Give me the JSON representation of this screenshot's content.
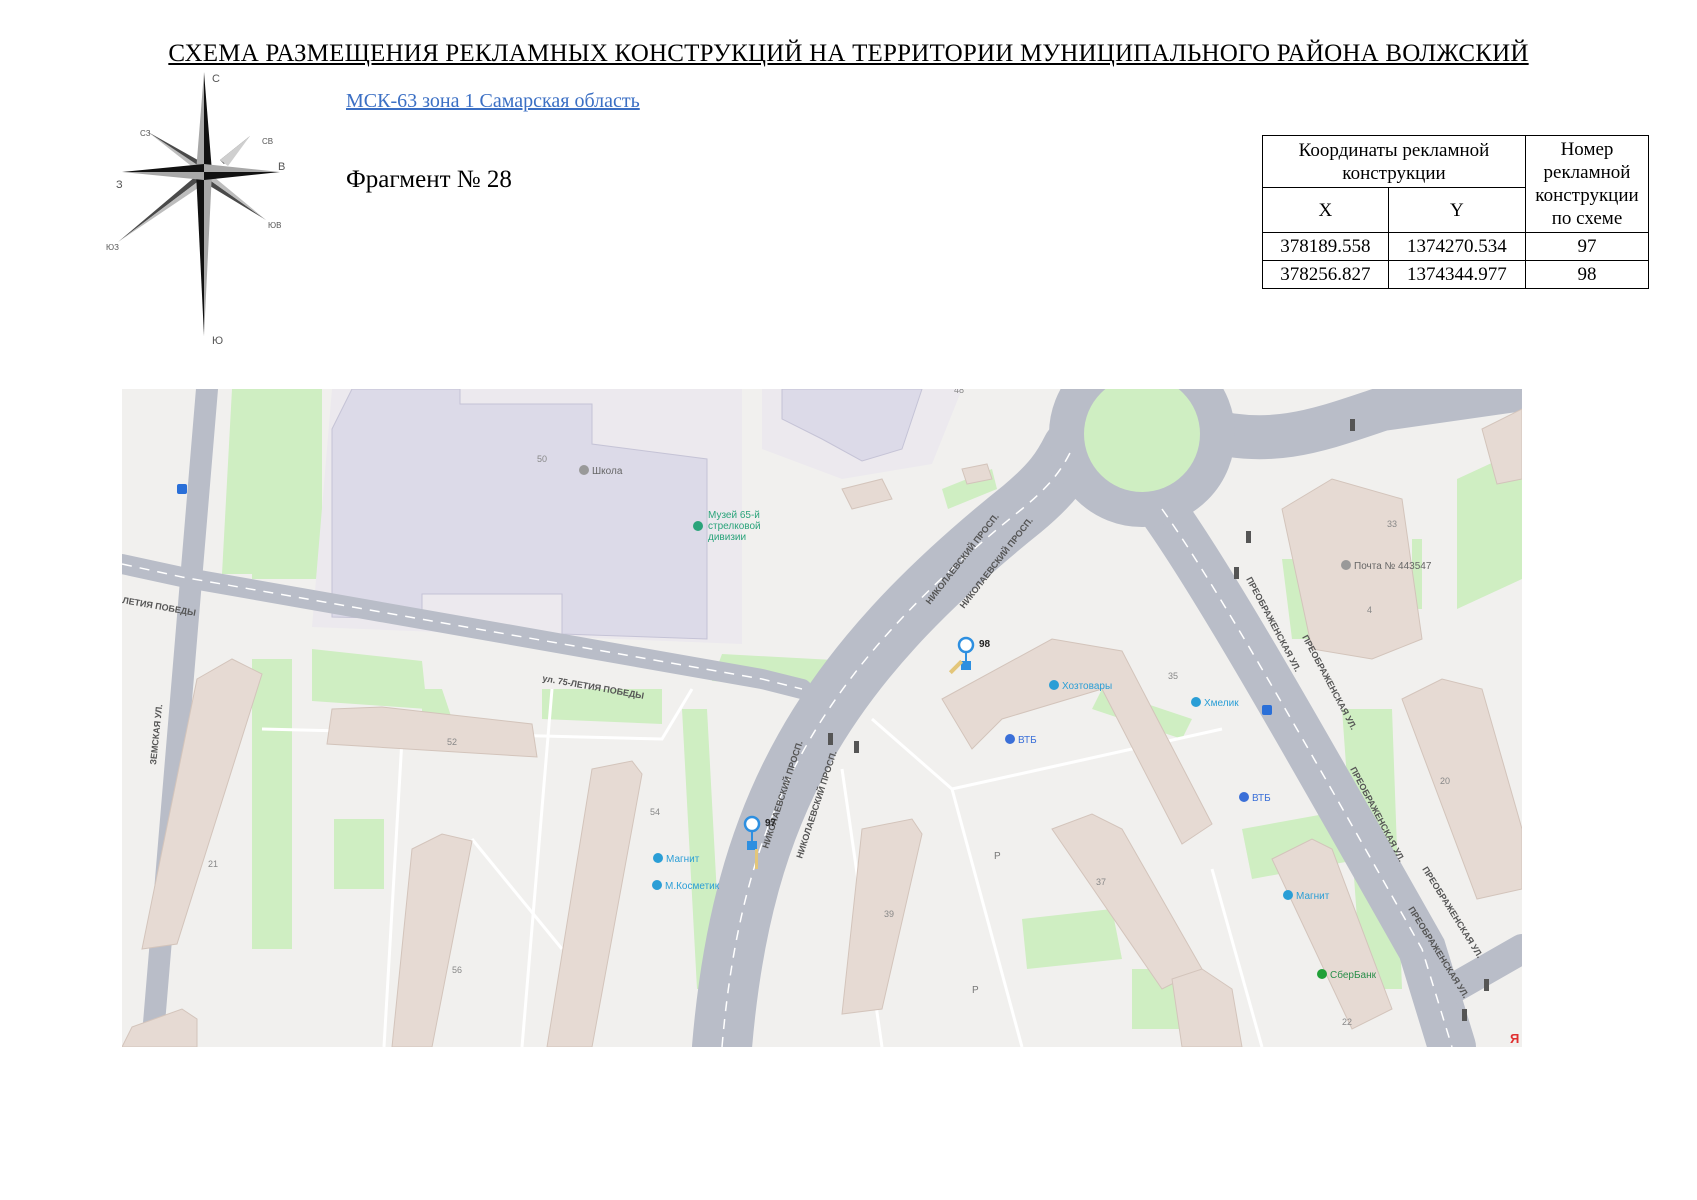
{
  "header": {
    "title": "СХЕМА РАЗМЕЩЕНИЯ РЕКЛАМНЫХ КОНСТРУКЦИЙ НА ТЕРРИТОРИИ МУНИЦИПАЛЬНОГО РАЙОНА ВОЛЖСКИЙ",
    "crs_link": "МСК-63 зона 1 Самарская область",
    "fragment": "Фрагмент № 28"
  },
  "compass": {
    "n": "С",
    "s": "Ю",
    "e": "В",
    "w": "З",
    "nw": "СЗ",
    "ne": "СВ",
    "se": "ЮВ",
    "sw": "ЮЗ"
  },
  "coords_table": {
    "header_coords": "Координаты рекламной конструкции",
    "header_x": "X",
    "header_y": "Y",
    "header_num": "Номер рекламной конструкции по схеме",
    "rows": [
      {
        "x": "378189.558",
        "y": "1374270.534",
        "num": "97"
      },
      {
        "x": "378256.827",
        "y": "1374344.977",
        "num": "98"
      }
    ]
  },
  "map": {
    "colors": {
      "road": "#b9bdc8",
      "green": "#cfeec2",
      "building": "#e6dad3",
      "school": "#dcdae8",
      "marker": "#2d8fe0"
    },
    "streets": {
      "pobedy_main": "ул. 75-ЛЕТИЯ ПОБЕДЫ",
      "pobedy_left": "ЛЕТИЯ ПОБЕДЫ",
      "zemskaya": "ЗЕМСКАЯ УЛ.",
      "nikolaevsky_1": "НИКОЛАЕВСКИЙ ПРОСП.",
      "nikolaevsky_2": "НИКОЛАЕВСКИЙ ПРОСП.",
      "nikolaevsky_3": "НИКОЛАЕВСКИЙ ПРОСП.",
      "nikolaevsky_4": "НИКОЛАЕВСКИЙ ПРОСП.",
      "preobr_1": "ПРЕОБРАЖЕНСКАЯ УЛ.",
      "preobr_2": "ПРЕОБРАЖЕНСКАЯ УЛ.",
      "preobr_3": "ПРЕОБРАЖЕНСКАЯ УЛ.",
      "preobr_4": "ПРЕОБРАЖЕНСКАЯ УЛ.",
      "preobr_5": "ПРЕОБРАЖЕНСКАЯ УЛ."
    },
    "pois": {
      "school": "Школа",
      "museum_1": "Музей 65-й",
      "museum_2": "стрелковой",
      "museum_3": "дивизии",
      "post": "Почта № 443547",
      "hoztovary": "Хозтовары",
      "hmelik": "Хмелик",
      "vtb_1": "ВТБ",
      "vtb_2": "ВТБ",
      "magnit_1": "Магнит",
      "kosmetik": "М.Косметик",
      "magnit_2": "Магнит",
      "sber": "СберБанк"
    },
    "houses": {
      "h50": "50",
      "h48": "48",
      "h33": "33",
      "h4": "4",
      "h35": "35",
      "h52": "52",
      "h54": "54",
      "h20": "20",
      "h21": "21",
      "h56": "56",
      "h39": "39",
      "h37": "37",
      "h22": "22"
    },
    "parking": {
      "p1": "P",
      "p2": "P"
    },
    "markers": {
      "m97": "97",
      "m98": "98"
    },
    "corner_logo": "Я"
  }
}
